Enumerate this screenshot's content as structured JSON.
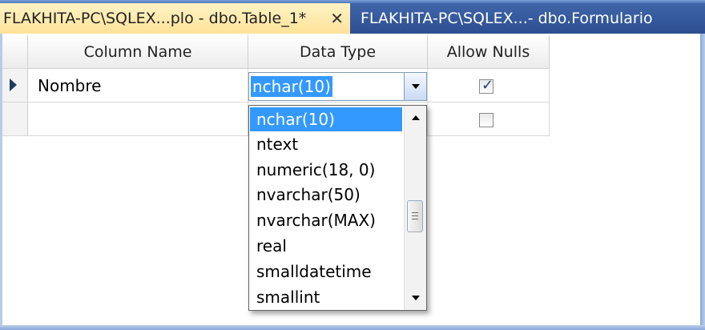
{
  "tabs": [
    {
      "label": "FLAKHITA-PC\\SQLEX...plo - dbo.Table_1*",
      "active": true
    },
    {
      "label": "FLAKHITA-PC\\SQLEX...- dbo.Formulario",
      "active": false
    }
  ],
  "tab_close_glyph": "✕",
  "grid": {
    "headers": {
      "column_name": "Column Name",
      "data_type": "Data Type",
      "allow_nulls": "Allow Nulls"
    },
    "rows": [
      {
        "column_name": "Nombre",
        "data_type": "nchar(10)",
        "allow_nulls": true,
        "current": true
      },
      {
        "column_name": "",
        "data_type": "",
        "allow_nulls": false,
        "current": false
      }
    ]
  },
  "combo": {
    "value": "nchar(10)",
    "icon": "chevron-down-icon"
  },
  "dropdown": {
    "options": [
      "nchar(10)",
      "ntext",
      "numeric(18, 0)",
      "nvarchar(50)",
      "nvarchar(MAX)",
      "real",
      "smalldatetime",
      "smallint"
    ],
    "selected_index": 0
  },
  "colors": {
    "selection": "#3399ff",
    "tab_active": "#ffe29a",
    "tab_inactive": "#2c4f92",
    "checkmark": "#1d3f7a"
  }
}
